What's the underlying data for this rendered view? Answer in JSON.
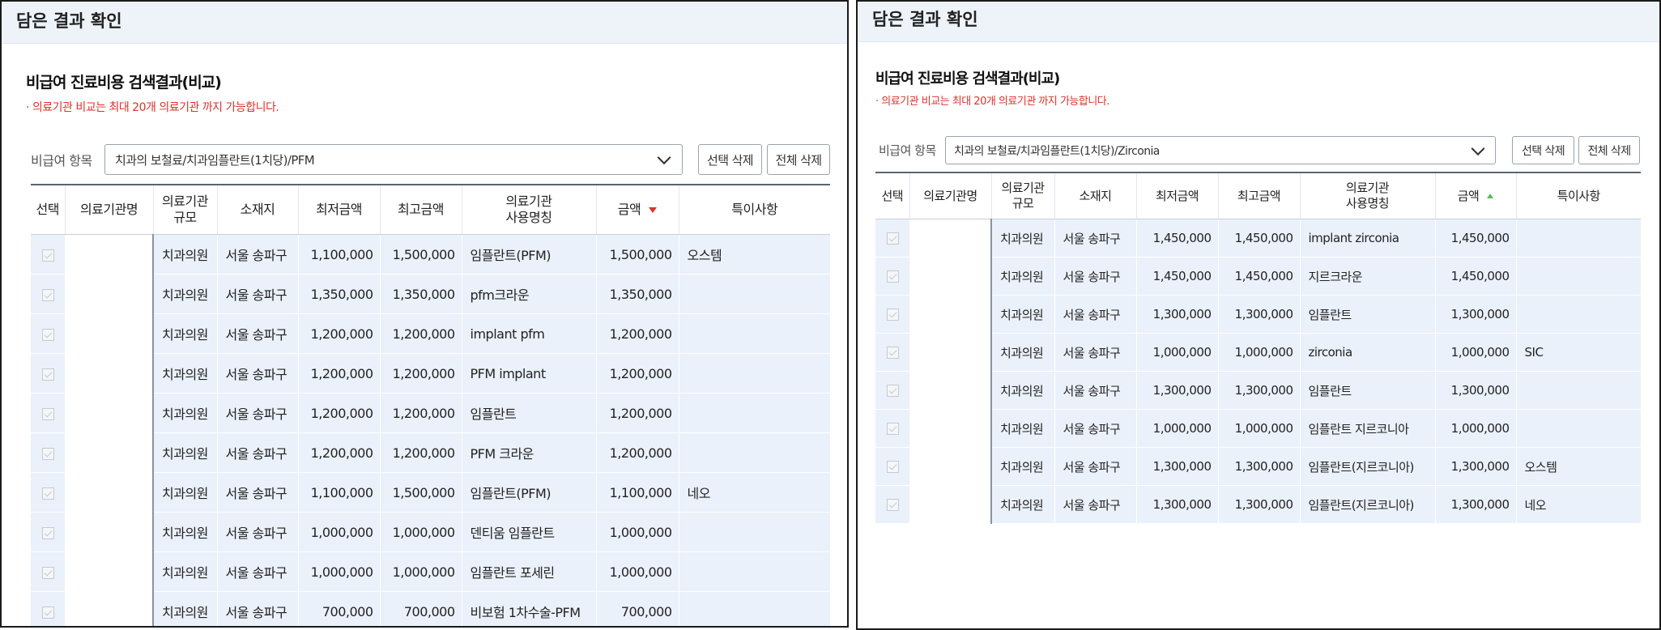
{
  "left": {
    "header": "담은 결과 확인",
    "title": "비급여 진료비용 검색결과(비교)",
    "notice": "· 의료기관 비교는 최대 20개 의료기관 까지 가능합니다.",
    "filter_label": "비급여 항목",
    "select_value": "치과의 보철료/치과임플란트(1치당)/PFM",
    "btn_delete_selected": "선택 삭제",
    "btn_delete_all": "전체 삭제",
    "columns": [
      "선택",
      "의료기관명",
      "의료기관\n규모",
      "소재지",
      "최저금액",
      "최고금액",
      "의료기관\n사용명칭",
      "금액",
      "특이사항"
    ],
    "rows": [
      {
        "scale": "치과의원",
        "location": "서울 송파구",
        "min": "1,100,000",
        "max": "1,500,000",
        "usage_name": "임플란트(PFM)",
        "amount": "1,500,000",
        "note": "오스템"
      },
      {
        "scale": "치과의원",
        "location": "서울 송파구",
        "min": "1,350,000",
        "max": "1,350,000",
        "usage_name": "pfm크라운",
        "amount": "1,350,000",
        "note": ""
      },
      {
        "scale": "치과의원",
        "location": "서울 송파구",
        "min": "1,200,000",
        "max": "1,200,000",
        "usage_name": "implant pfm",
        "amount": "1,200,000",
        "note": ""
      },
      {
        "scale": "치과의원",
        "location": "서울 송파구",
        "min": "1,200,000",
        "max": "1,200,000",
        "usage_name": "PFM implant",
        "amount": "1,200,000",
        "note": ""
      },
      {
        "scale": "치과의원",
        "location": "서울 송파구",
        "min": "1,200,000",
        "max": "1,200,000",
        "usage_name": "임플란트",
        "amount": "1,200,000",
        "note": ""
      },
      {
        "scale": "치과의원",
        "location": "서울 송파구",
        "min": "1,200,000",
        "max": "1,200,000",
        "usage_name": "PFM 크라운",
        "amount": "1,200,000",
        "note": ""
      },
      {
        "scale": "치과의원",
        "location": "서울 송파구",
        "min": "1,100,000",
        "max": "1,500,000",
        "usage_name": "임플란트(PFM)",
        "amount": "1,100,000",
        "note": "네오"
      },
      {
        "scale": "치과의원",
        "location": "서울 송파구",
        "min": "1,000,000",
        "max": "1,000,000",
        "usage_name": "덴티움 임플란트",
        "amount": "1,000,000",
        "note": ""
      },
      {
        "scale": "치과의원",
        "location": "서울 송파구",
        "min": "1,000,000",
        "max": "1,000,000",
        "usage_name": "임플란트 포세린",
        "amount": "1,000,000",
        "note": ""
      },
      {
        "scale": "치과의원",
        "location": "서울 송파구",
        "min": "700,000",
        "max": "700,000",
        "usage_name": "비보험 1차수술-PFM",
        "amount": "700,000",
        "note": ""
      }
    ]
  },
  "right": {
    "header": "담은 결과 확인",
    "title": "비급여 진료비용 검색결과(비교)",
    "notice": "· 의료기관 비교는 최대 20개 의료기관 까지 가능합니다.",
    "filter_label": "비급여 항목",
    "select_value": "치과의 보철료/치과임플란트(1치당)/Zirconia",
    "btn_delete_selected": "선택 삭제",
    "btn_delete_all": "전체 삭제",
    "columns": [
      "선택",
      "의료기관명",
      "의료기관\n규모",
      "소재지",
      "최저금액",
      "최고금액",
      "의료기관\n사용명칭",
      "금액",
      "특이사항"
    ],
    "rows": [
      {
        "scale": "치과의원",
        "location": "서울 송파구",
        "min": "1,450,000",
        "max": "1,450,000",
        "usage_name": "implant zirconia",
        "amount": "1,450,000",
        "note": ""
      },
      {
        "scale": "치과의원",
        "location": "서울 송파구",
        "min": "1,450,000",
        "max": "1,450,000",
        "usage_name": "지르크라운",
        "amount": "1,450,000",
        "note": ""
      },
      {
        "scale": "치과의원",
        "location": "서울 송파구",
        "min": "1,300,000",
        "max": "1,300,000",
        "usage_name": "임플란트",
        "amount": "1,300,000",
        "note": ""
      },
      {
        "scale": "치과의원",
        "location": "서울 송파구",
        "min": "1,000,000",
        "max": "1,000,000",
        "usage_name": "zirconia",
        "amount": "1,000,000",
        "note": "SIC"
      },
      {
        "scale": "치과의원",
        "location": "서울 송파구",
        "min": "1,300,000",
        "max": "1,300,000",
        "usage_name": "임플란트",
        "amount": "1,300,000",
        "note": ""
      },
      {
        "scale": "치과의원",
        "location": "서울 송파구",
        "min": "1,000,000",
        "max": "1,000,000",
        "usage_name": "임플란트 지르코니아",
        "amount": "1,000,000",
        "note": ""
      },
      {
        "scale": "치과의원",
        "location": "서울 송파구",
        "min": "1,300,000",
        "max": "1,300,000",
        "usage_name": "임플란트(지르코니아)",
        "amount": "1,300,000",
        "note": "오스템"
      },
      {
        "scale": "치과의원",
        "location": "서울 송파구",
        "min": "1,300,000",
        "max": "1,300,000",
        "usage_name": "임플란트(지르코니아)",
        "amount": "1,300,000",
        "note": "네오"
      }
    ]
  },
  "colors": {
    "header_bg": "#eef3fa",
    "row_bg": "#eaf1fb",
    "notice": "#e0302b",
    "sort_desc": "#e0302b",
    "sort_asc": "#5cb85c"
  },
  "icons": {
    "sort_left": "sort-desc-icon",
    "sort_right": "sort-asc-icon",
    "dropdown": "chevron-down-icon",
    "checkbox": "checkbox-icon"
  }
}
